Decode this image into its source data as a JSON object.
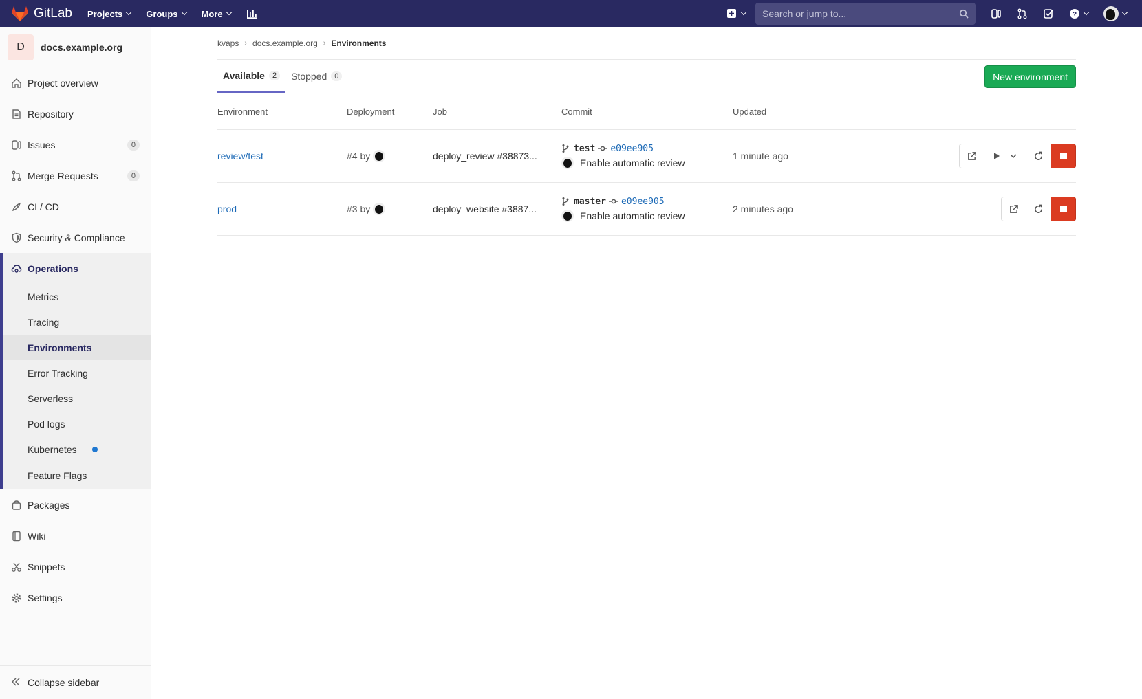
{
  "navbar": {
    "brand": "GitLab",
    "menu": [
      "Projects",
      "Groups",
      "More"
    ],
    "search_placeholder": "Search or jump to..."
  },
  "sidebar": {
    "project_initial": "D",
    "project_name": "docs.example.org",
    "items_top": [
      {
        "label": "Project overview",
        "icon": "home-icon"
      },
      {
        "label": "Repository",
        "icon": "repository-icon"
      },
      {
        "label": "Issues",
        "icon": "issues-icon",
        "count": "0"
      },
      {
        "label": "Merge Requests",
        "icon": "merge-request-icon",
        "count": "0"
      },
      {
        "label": "CI / CD",
        "icon": "rocket-icon"
      },
      {
        "label": "Security & Compliance",
        "icon": "shield-icon"
      }
    ],
    "operations": {
      "label": "Operations",
      "items": [
        "Metrics",
        "Tracing",
        "Environments",
        "Error Tracking",
        "Serverless",
        "Pod logs",
        "Kubernetes",
        "Feature Flags"
      ],
      "active": "Environments"
    },
    "items_bottom": [
      {
        "label": "Packages",
        "icon": "package-icon"
      },
      {
        "label": "Wiki",
        "icon": "book-icon"
      },
      {
        "label": "Snippets",
        "icon": "scissors-icon"
      },
      {
        "label": "Settings",
        "icon": "gear-icon"
      }
    ],
    "collapse_label": "Collapse sidebar"
  },
  "breadcrumb": [
    "kvaps",
    "docs.example.org",
    "Environments"
  ],
  "tabs": [
    {
      "label": "Available",
      "count": "2"
    },
    {
      "label": "Stopped",
      "count": "0"
    }
  ],
  "new_environment_label": "New environment",
  "table": {
    "headers": [
      "Environment",
      "Deployment",
      "Job",
      "Commit",
      "Updated"
    ],
    "rows": [
      {
        "environment": "review/test",
        "deployment": "#4 by",
        "job": "deploy_review #38873...",
        "branch": "test",
        "sha": "e09ee905",
        "message": "Enable automatic review",
        "updated": "1 minute ago"
      },
      {
        "environment": "prod",
        "deployment": "#3 by",
        "job": "deploy_website #3887...",
        "branch": "master",
        "sha": "e09ee905",
        "message": "Enable automatic review",
        "updated": "2 minutes ago"
      }
    ]
  },
  "colors": {
    "navbar": "#292961",
    "new_button": "#1aaa55",
    "stop_button": "#db3b21",
    "link": "#1b69b6"
  }
}
